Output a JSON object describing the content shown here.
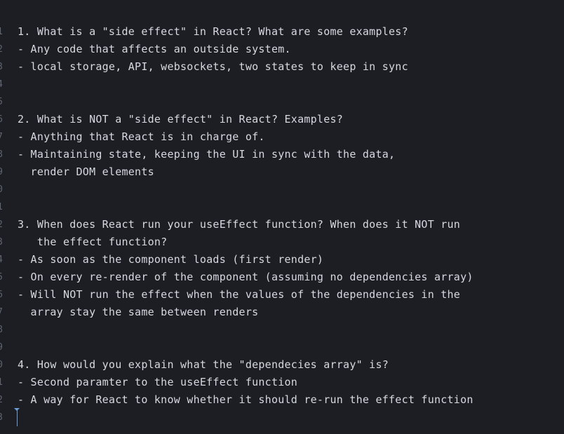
{
  "editor": {
    "lines": [
      {
        "num": "1",
        "text": "1. What is a \"side effect\" in React? What are some examples?"
      },
      {
        "num": "2",
        "text": "- Any code that affects an outside system."
      },
      {
        "num": "3",
        "text": "- local storage, API, websockets, two states to keep in sync"
      },
      {
        "num": "4",
        "text": ""
      },
      {
        "num": "5",
        "text": ""
      },
      {
        "num": "6",
        "text": "2. What is NOT a \"side effect\" in React? Examples?"
      },
      {
        "num": "7",
        "text": "- Anything that React is in charge of."
      },
      {
        "num": "8",
        "text": "- Maintaining state, keeping the UI in sync with the data,"
      },
      {
        "num": "9",
        "text": "  render DOM elements"
      },
      {
        "num": "0",
        "text": ""
      },
      {
        "num": "1",
        "text": ""
      },
      {
        "num": "2",
        "text": "3. When does React run your useEffect function? When does it NOT run"
      },
      {
        "num": "3",
        "text": "   the effect function?"
      },
      {
        "num": "4",
        "text": "- As soon as the component loads (first render)"
      },
      {
        "num": "5",
        "text": "- On every re-render of the component (assuming no dependencies array)"
      },
      {
        "num": "6",
        "text": "- Will NOT run the effect when the values of the dependencies in the"
      },
      {
        "num": "7",
        "text": "  array stay the same between renders"
      },
      {
        "num": "8",
        "text": ""
      },
      {
        "num": "9",
        "text": ""
      },
      {
        "num": "0",
        "text": "4. How would you explain what the \"dependecies array\" is?"
      },
      {
        "num": "1",
        "text": "- Second paramter to the useEffect function"
      },
      {
        "num": "2",
        "text": "- A way for React to know whether it should re-run the effect function"
      },
      {
        "num": "3",
        "text": ""
      }
    ]
  }
}
